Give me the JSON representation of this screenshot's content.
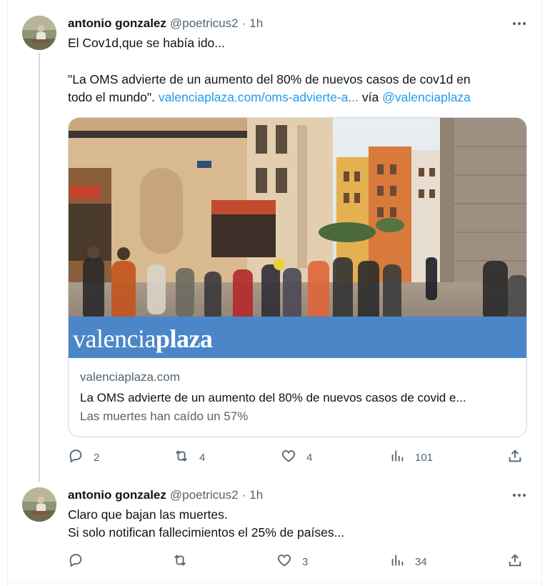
{
  "tweets": [
    {
      "author": {
        "name": "antonio gonzalez",
        "handle": "@poetricus2"
      },
      "separator": "·",
      "time": "1h",
      "text_line1": "El Cov1d,que se había ido...",
      "text_line2": "\"La OMS advierte de un aumento del 80% de nuevos casos de cov1d en",
      "text_line3_prefix": "todo el mundo\".",
      "text_line3_link": "valenciaplaza.com/oms-advierte-a...",
      "text_line3_via": "vía",
      "text_line3_mention": "@valenciaplaza",
      "card": {
        "logo_regular": "valencia",
        "logo_bold": "plaza",
        "domain": "valenciaplaza.com",
        "title": "La OMS advierte de un aumento del 80% de nuevos casos de covid e...",
        "description": "Las muertes han caído un 57%"
      },
      "stats": {
        "replies": "2",
        "reposts": "4",
        "likes": "4",
        "views": "101"
      }
    },
    {
      "author": {
        "name": "antonio gonzalez",
        "handle": "@poetricus2"
      },
      "separator": "·",
      "time": "1h",
      "text_line1": "Claro que bajan las muertes.",
      "text_line2": "Si solo notifican fallecimientos el 25% de países...",
      "stats": {
        "replies": "",
        "reposts": "",
        "likes": "3",
        "views": "34"
      }
    }
  ],
  "icons": {
    "more": "more-horizontal-icon",
    "reply": "reply-icon",
    "repost": "repost-icon",
    "like": "like-icon",
    "views": "views-icon",
    "share": "share-icon"
  },
  "colors": {
    "link": "#1d9bf0",
    "secondary_text": "#536471",
    "logo_band": "#4a86c8",
    "thread_line": "#cfd9de"
  }
}
